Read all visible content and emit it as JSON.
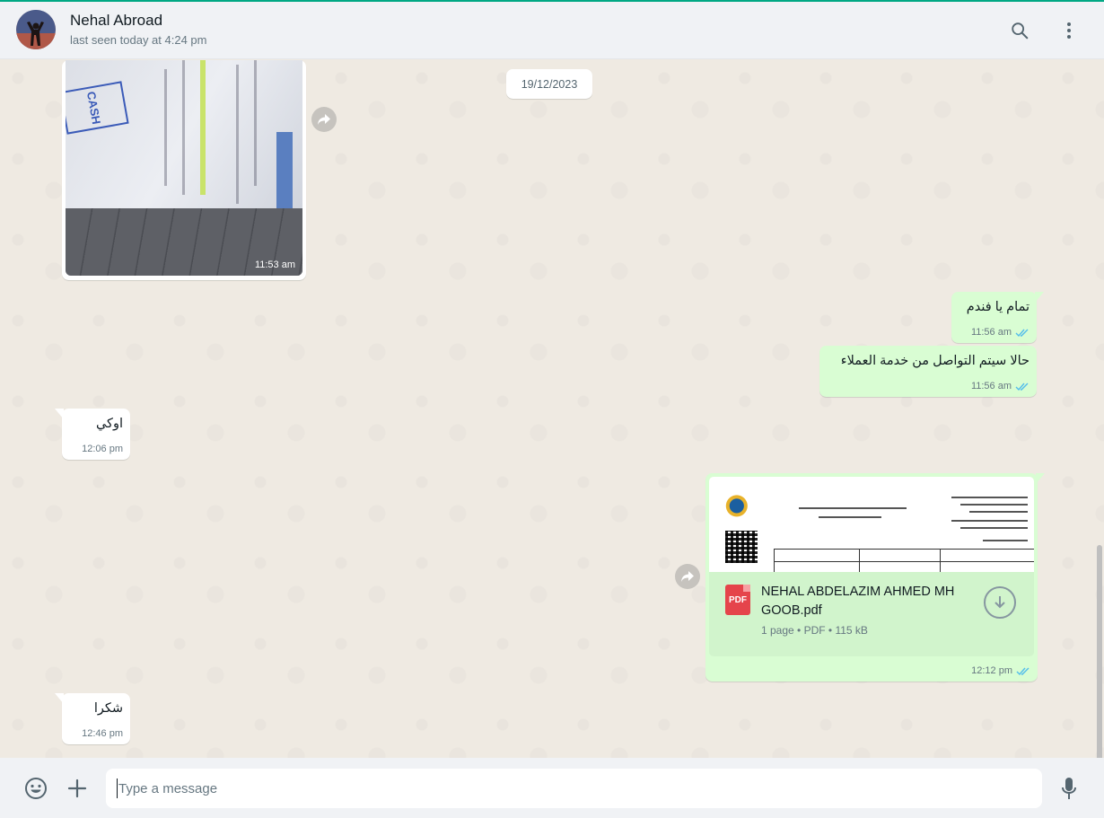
{
  "header": {
    "contact_name": "Nehal Abroad",
    "status": "last seen today at 4:24 pm",
    "icons": [
      "search-icon",
      "menu-icon"
    ]
  },
  "chat": {
    "date_label": "19/12/2023",
    "messages": [
      {
        "direction": "in",
        "type": "image",
        "time": "11:53 am",
        "photo_stamp_text": "CASH"
      },
      {
        "direction": "out",
        "type": "text",
        "text": "تمام يا فندم",
        "time": "11:56 am",
        "status": "read"
      },
      {
        "direction": "out",
        "type": "text",
        "text": "حالا سيتم التواصل من خدمة العملاء",
        "time": "11:56 am",
        "status": "read"
      },
      {
        "direction": "in",
        "type": "text",
        "text": "اوكي",
        "time": "12:06 pm"
      },
      {
        "direction": "out",
        "type": "document",
        "file_name": "NEHAL ABDELAZIM AHMED MH GOOB.pdf",
        "meta": "1 page • PDF • 115 kB",
        "file_icon_label": "PDF",
        "time": "12:12 pm",
        "status": "read"
      },
      {
        "direction": "in",
        "type": "text",
        "text": "شكرا",
        "time": "12:46 pm"
      }
    ]
  },
  "footer": {
    "placeholder": "Type a message",
    "icons": [
      "emoji-icon",
      "plus-icon",
      "microphone-icon"
    ]
  },
  "colors": {
    "accent": "#00a884",
    "incoming_bubble": "#ffffff",
    "outgoing_bubble": "#d9fdd3",
    "read_ticks": "#53bdeb",
    "chat_background": "#efeae2"
  }
}
